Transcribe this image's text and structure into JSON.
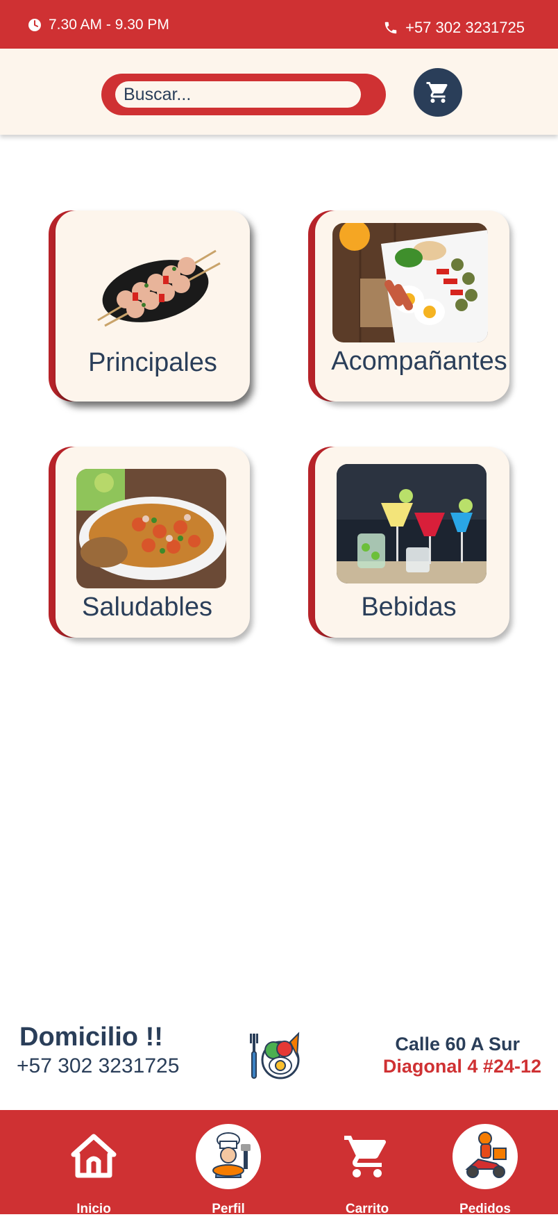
{
  "topbar": {
    "hours": "7.30 AM - 9.30 PM",
    "phone": "+57 302 3231725",
    "background": "#cf3133"
  },
  "search": {
    "placeholder": "Buscar...",
    "value": ""
  },
  "categories": [
    {
      "label": "Principales",
      "image": "chicken-skewers-image"
    },
    {
      "label": "Acompañantes",
      "image": "breakfast-plate-image"
    },
    {
      "label": "Saludables",
      "image": "fried-fish-image"
    },
    {
      "label": "Bebidas",
      "image": "cocktails-image"
    }
  ],
  "footer": {
    "title": "Domicilio !!",
    "phone": "+57 302 3231725",
    "address_line1": "Calle 60 A Sur",
    "address_line2": "Diagonal 4  #24-12"
  },
  "nav": [
    {
      "label": "Inicio",
      "icon": "home-icon"
    },
    {
      "label": "Perfil",
      "icon": "chef-avatar-icon"
    },
    {
      "label": "Carrito",
      "icon": "cart-icon"
    },
    {
      "label": "Pedidos",
      "icon": "delivery-scooter-icon"
    }
  ],
  "colors": {
    "primary_red": "#cf3133",
    "navy": "#2a3e59",
    "cream": "#fdf5ec"
  }
}
